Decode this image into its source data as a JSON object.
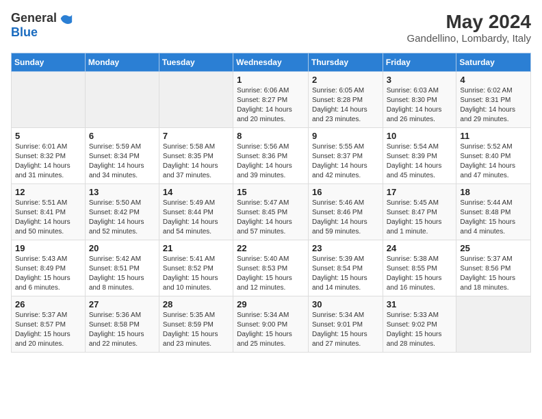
{
  "header": {
    "logo_line1": "General",
    "logo_line2": "Blue",
    "month_year": "May 2024",
    "location": "Gandellino, Lombardy, Italy"
  },
  "weekdays": [
    "Sunday",
    "Monday",
    "Tuesday",
    "Wednesday",
    "Thursday",
    "Friday",
    "Saturday"
  ],
  "weeks": [
    [
      {
        "day": "",
        "info": ""
      },
      {
        "day": "",
        "info": ""
      },
      {
        "day": "",
        "info": ""
      },
      {
        "day": "1",
        "info": "Sunrise: 6:06 AM\nSunset: 8:27 PM\nDaylight: 14 hours\nand 20 minutes."
      },
      {
        "day": "2",
        "info": "Sunrise: 6:05 AM\nSunset: 8:28 PM\nDaylight: 14 hours\nand 23 minutes."
      },
      {
        "day": "3",
        "info": "Sunrise: 6:03 AM\nSunset: 8:30 PM\nDaylight: 14 hours\nand 26 minutes."
      },
      {
        "day": "4",
        "info": "Sunrise: 6:02 AM\nSunset: 8:31 PM\nDaylight: 14 hours\nand 29 minutes."
      }
    ],
    [
      {
        "day": "5",
        "info": "Sunrise: 6:01 AM\nSunset: 8:32 PM\nDaylight: 14 hours\nand 31 minutes."
      },
      {
        "day": "6",
        "info": "Sunrise: 5:59 AM\nSunset: 8:34 PM\nDaylight: 14 hours\nand 34 minutes."
      },
      {
        "day": "7",
        "info": "Sunrise: 5:58 AM\nSunset: 8:35 PM\nDaylight: 14 hours\nand 37 minutes."
      },
      {
        "day": "8",
        "info": "Sunrise: 5:56 AM\nSunset: 8:36 PM\nDaylight: 14 hours\nand 39 minutes."
      },
      {
        "day": "9",
        "info": "Sunrise: 5:55 AM\nSunset: 8:37 PM\nDaylight: 14 hours\nand 42 minutes."
      },
      {
        "day": "10",
        "info": "Sunrise: 5:54 AM\nSunset: 8:39 PM\nDaylight: 14 hours\nand 45 minutes."
      },
      {
        "day": "11",
        "info": "Sunrise: 5:52 AM\nSunset: 8:40 PM\nDaylight: 14 hours\nand 47 minutes."
      }
    ],
    [
      {
        "day": "12",
        "info": "Sunrise: 5:51 AM\nSunset: 8:41 PM\nDaylight: 14 hours\nand 50 minutes."
      },
      {
        "day": "13",
        "info": "Sunrise: 5:50 AM\nSunset: 8:42 PM\nDaylight: 14 hours\nand 52 minutes."
      },
      {
        "day": "14",
        "info": "Sunrise: 5:49 AM\nSunset: 8:44 PM\nDaylight: 14 hours\nand 54 minutes."
      },
      {
        "day": "15",
        "info": "Sunrise: 5:47 AM\nSunset: 8:45 PM\nDaylight: 14 hours\nand 57 minutes."
      },
      {
        "day": "16",
        "info": "Sunrise: 5:46 AM\nSunset: 8:46 PM\nDaylight: 14 hours\nand 59 minutes."
      },
      {
        "day": "17",
        "info": "Sunrise: 5:45 AM\nSunset: 8:47 PM\nDaylight: 15 hours\nand 1 minute."
      },
      {
        "day": "18",
        "info": "Sunrise: 5:44 AM\nSunset: 8:48 PM\nDaylight: 15 hours\nand 4 minutes."
      }
    ],
    [
      {
        "day": "19",
        "info": "Sunrise: 5:43 AM\nSunset: 8:49 PM\nDaylight: 15 hours\nand 6 minutes."
      },
      {
        "day": "20",
        "info": "Sunrise: 5:42 AM\nSunset: 8:51 PM\nDaylight: 15 hours\nand 8 minutes."
      },
      {
        "day": "21",
        "info": "Sunrise: 5:41 AM\nSunset: 8:52 PM\nDaylight: 15 hours\nand 10 minutes."
      },
      {
        "day": "22",
        "info": "Sunrise: 5:40 AM\nSunset: 8:53 PM\nDaylight: 15 hours\nand 12 minutes."
      },
      {
        "day": "23",
        "info": "Sunrise: 5:39 AM\nSunset: 8:54 PM\nDaylight: 15 hours\nand 14 minutes."
      },
      {
        "day": "24",
        "info": "Sunrise: 5:38 AM\nSunset: 8:55 PM\nDaylight: 15 hours\nand 16 minutes."
      },
      {
        "day": "25",
        "info": "Sunrise: 5:37 AM\nSunset: 8:56 PM\nDaylight: 15 hours\nand 18 minutes."
      }
    ],
    [
      {
        "day": "26",
        "info": "Sunrise: 5:37 AM\nSunset: 8:57 PM\nDaylight: 15 hours\nand 20 minutes."
      },
      {
        "day": "27",
        "info": "Sunrise: 5:36 AM\nSunset: 8:58 PM\nDaylight: 15 hours\nand 22 minutes."
      },
      {
        "day": "28",
        "info": "Sunrise: 5:35 AM\nSunset: 8:59 PM\nDaylight: 15 hours\nand 23 minutes."
      },
      {
        "day": "29",
        "info": "Sunrise: 5:34 AM\nSunset: 9:00 PM\nDaylight: 15 hours\nand 25 minutes."
      },
      {
        "day": "30",
        "info": "Sunrise: 5:34 AM\nSunset: 9:01 PM\nDaylight: 15 hours\nand 27 minutes."
      },
      {
        "day": "31",
        "info": "Sunrise: 5:33 AM\nSunset: 9:02 PM\nDaylight: 15 hours\nand 28 minutes."
      },
      {
        "day": "",
        "info": ""
      }
    ]
  ]
}
